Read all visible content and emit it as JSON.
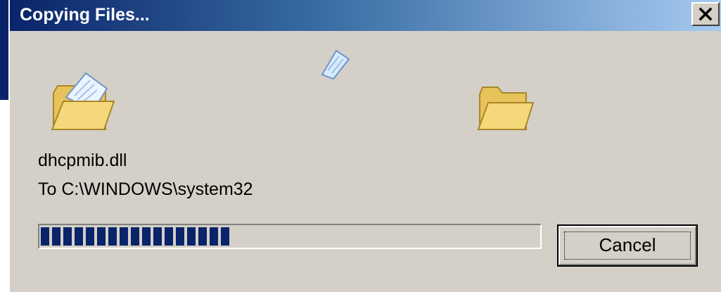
{
  "window": {
    "title": "Copying Files...",
    "close_symbol": "×"
  },
  "icons": {
    "source": "folder-open-with-document-icon",
    "flying": "flying-document-icon",
    "destination": "folder-open-icon"
  },
  "file": {
    "name": "dhcpmib.dll",
    "destination": "To C:\\WINDOWS\\system32"
  },
  "progress": {
    "fraction": 0.39
  },
  "buttons": {
    "cancel": "Cancel"
  },
  "colors": {
    "accent": "#0a246a",
    "face": "#d4d0c8"
  }
}
